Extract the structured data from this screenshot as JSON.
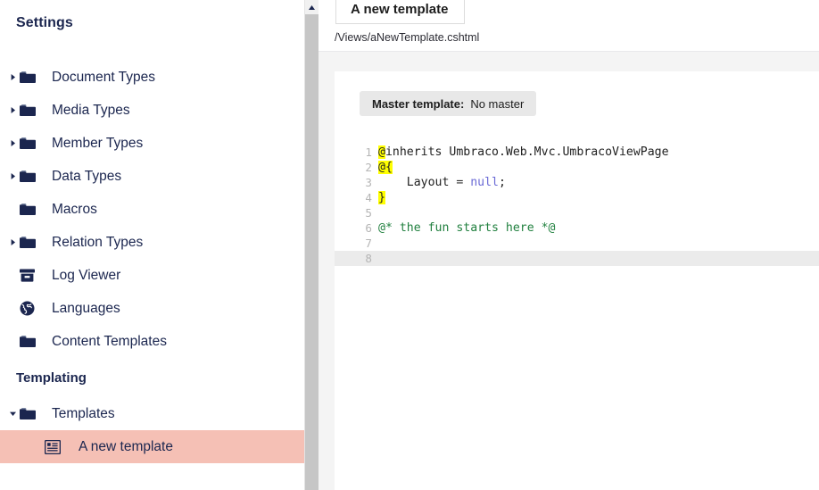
{
  "sidebar": {
    "title": "Settings",
    "items": [
      {
        "label": "Document Types",
        "icon": "folder-icon",
        "caret": true,
        "selected": false,
        "child": false
      },
      {
        "label": "Media Types",
        "icon": "folder-icon",
        "caret": true,
        "selected": false,
        "child": false
      },
      {
        "label": "Member Types",
        "icon": "folder-icon",
        "caret": true,
        "selected": false,
        "child": false
      },
      {
        "label": "Data Types",
        "icon": "folder-icon",
        "caret": true,
        "selected": false,
        "child": false
      },
      {
        "label": "Macros",
        "icon": "folder-icon",
        "caret": false,
        "selected": false,
        "child": false
      },
      {
        "label": "Relation Types",
        "icon": "folder-icon",
        "caret": true,
        "selected": false,
        "child": false
      },
      {
        "label": "Log Viewer",
        "icon": "archive-icon",
        "caret": false,
        "selected": false,
        "child": false
      },
      {
        "label": "Languages",
        "icon": "globe-icon",
        "caret": false,
        "selected": false,
        "child": false
      },
      {
        "label": "Content Templates",
        "icon": "folder-icon",
        "caret": false,
        "selected": false,
        "child": false
      }
    ],
    "section_heading": "Templating",
    "templating_items": [
      {
        "label": "Templates",
        "icon": "folder-open-icon",
        "caret": true,
        "caret_open": true,
        "selected": false,
        "child": false
      },
      {
        "label": "A new template",
        "icon": "article-icon",
        "caret": false,
        "caret_open": false,
        "selected": true,
        "child": true
      }
    ],
    "selected_color": "#f5c0b5",
    "text_color": "#1b264f"
  },
  "scrollbar": {
    "up_arrow_icon": "chevron-up-icon",
    "thumb_color": "#c6c6c6"
  },
  "main": {
    "tab_title": "A new template",
    "file_path": "/Views/aNewTemplate.cshtml",
    "master_template_label": "Master template:",
    "master_template_value": "No master"
  },
  "editor": {
    "active_line": 8,
    "gutter_color": "#b5b5b5",
    "active_line_color": "#ebebeb",
    "highlight_color": "#ffff00",
    "comment_color": "#21803f",
    "keyword_color": "#6b6bd6",
    "lines": [
      {
        "n": "1",
        "tokens": [
          {
            "t": "@",
            "c": "hl"
          },
          {
            "t": "inherits Umbraco.Web.Mvc.UmbracoViewPage",
            "c": "cc"
          }
        ]
      },
      {
        "n": "2",
        "tokens": [
          {
            "t": "@{",
            "c": "hl"
          }
        ]
      },
      {
        "n": "3",
        "tokens": [
          {
            "t": "    Layout ",
            "c": "cc"
          },
          {
            "t": "= ",
            "c": "op"
          },
          {
            "t": "null",
            "c": "kw-null"
          },
          {
            "t": ";",
            "c": "cc"
          }
        ]
      },
      {
        "n": "4",
        "tokens": [
          {
            "t": "}",
            "c": "hl"
          }
        ]
      },
      {
        "n": "5",
        "tokens": []
      },
      {
        "n": "6",
        "tokens": [
          {
            "t": "@* the fun starts here *@",
            "c": "cmt"
          }
        ]
      },
      {
        "n": "7",
        "tokens": []
      },
      {
        "n": "8",
        "tokens": []
      }
    ]
  }
}
